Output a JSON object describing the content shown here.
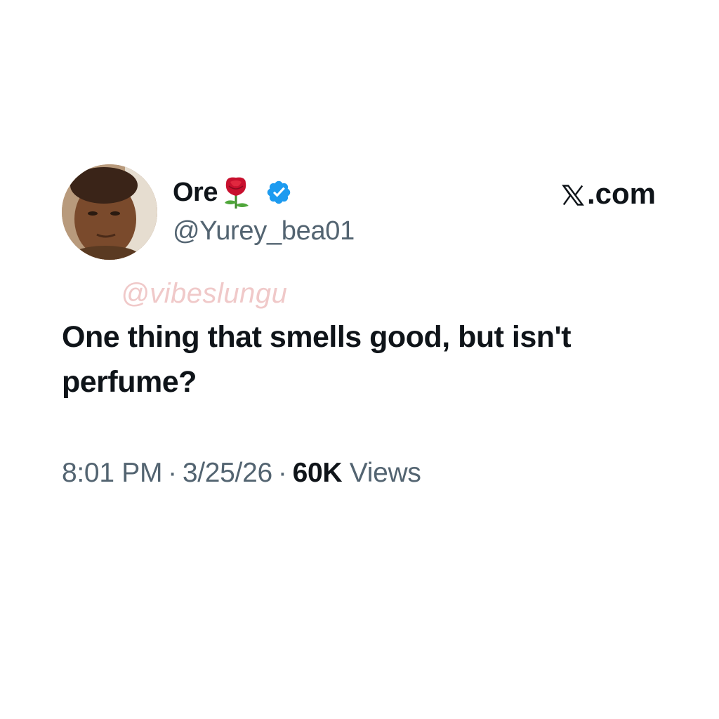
{
  "tweet": {
    "display_name": "Ore",
    "handle": "@Yurey_bea01",
    "site": ".com",
    "watermark": "@vibeslungu",
    "text": "One thing that smells good, but isn't perfume?",
    "time": "8:01 PM",
    "separator": "·",
    "date": "3/25/26",
    "views_count": "60K",
    "views_label": "Views",
    "icons": {
      "name_emoji": "rose-icon",
      "badge": "verified-badge-icon",
      "logo": "x-logo-icon"
    },
    "colors": {
      "text": "#0f1419",
      "secondary": "#536471",
      "verified": "#1d9bf0",
      "watermark": "#f0c9c9"
    }
  }
}
